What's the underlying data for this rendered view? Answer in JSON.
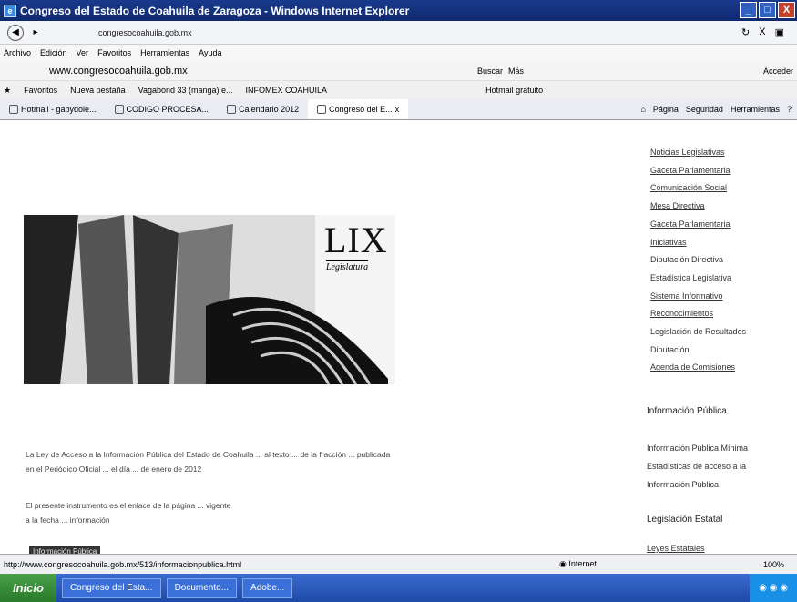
{
  "window": {
    "title": "Congreso del Estado de Coahuila de Zaragoza - Windows Internet Explorer",
    "buttons": [
      "_",
      "□",
      "X"
    ]
  },
  "addressbar": {
    "url": "congresocoahuila.gob.mx",
    "back_icon": "back-arrow-icon",
    "right_text": "X"
  },
  "menubar": {
    "items": [
      "Archivo",
      "Edición",
      "Ver",
      "Favoritos",
      "Herramientas",
      "Ayuda"
    ]
  },
  "searchbar": {
    "site": "www.congresocoahuila.gob.mx",
    "search_label": "Buscar",
    "more_label": "Más",
    "right_label": "Acceder"
  },
  "favorites": {
    "label": "Favoritos",
    "items": [
      "Nueva pestaña",
      "Vagabond 33 (manga) e...",
      "INFOMEX COAHUILA",
      "Hotmail gratuito"
    ]
  },
  "tabs": {
    "items": [
      "Hotmail - gabydole...",
      "CODIGO PROCESA...",
      "Calendario 2012",
      "Congreso del E..."
    ],
    "close": "x",
    "right_items": [
      "Página",
      "Seguridad",
      "Herramientas"
    ]
  },
  "banner": {
    "title": "LIX",
    "subtitle": "Legislatura"
  },
  "sidenav": {
    "items": [
      "Noticias Legislativas",
      "Gaceta Parlamentaria",
      "Comunicación Social",
      "Mesa Directiva",
      "Gaceta Parlamentaria",
      "Iniciativas",
      "Diputación Directiva",
      "Estadística Legislativa",
      "Sistema Informativo",
      "Reconocimientos",
      "Legislación de Resultados",
      "Diputación",
      "Agenda de Comisiones"
    ]
  },
  "info_section": {
    "heading": "Información Pública",
    "links": [
      "Información Pública Mínima",
      "Estadísticas de acceso a la",
      "Información Pública"
    ]
  },
  "legislation": {
    "heading": "Legislación Estatal",
    "links": [
      "Leyes Estatales"
    ]
  },
  "main_text": {
    "para1_line1": "La Ley de Acceso a la Información Pública del Estado de Coahuila ... al texto ... de la fracción ... publicada",
    "para1_line2": "en el Periódico Oficial ... el día ... de enero de 2012",
    "para2_line1": "El presente instrumento es el enlace de la página ... vigente",
    "para2_line2": "a la fecha ... información",
    "highlight": "Información Pública"
  },
  "statusbar": {
    "url": "http://www.congresocoahuila.gob.mx/513/informacionpublica.html",
    "zone": "Internet",
    "zoom": "100%"
  },
  "taskbar": {
    "start": "Inicio",
    "tasks": [
      "Congreso del Esta...",
      "Documento...",
      "Adobe..."
    ]
  },
  "colors": {
    "titlebar": "#1a3a8c",
    "taskbar": "#1e4aa8",
    "start": "#2a7a2a"
  }
}
